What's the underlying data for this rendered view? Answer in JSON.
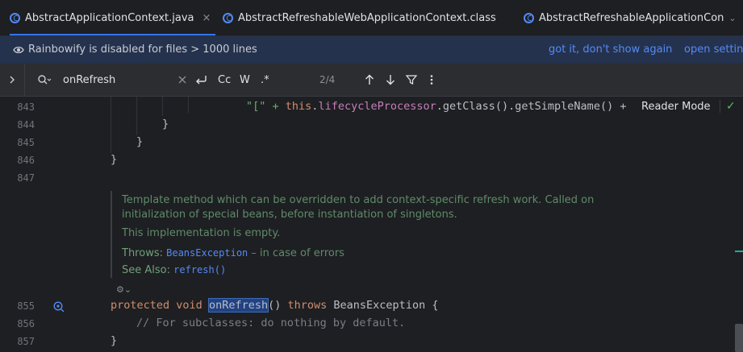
{
  "tabs": [
    {
      "label": "AbstractApplicationContext.java",
      "close": "×"
    },
    {
      "label": "AbstractRefreshableWebApplicationContext.class"
    },
    {
      "label": "AbstractRefreshableApplicationCon"
    }
  ],
  "banner": {
    "text": "Rainbowify is disabled for files > 1000 lines",
    "link_got_it": "got it, don't show again",
    "link_open_settings": "open settin"
  },
  "find": {
    "query": "onRefresh",
    "match_case": "Cc",
    "words": "W",
    "regex": ".*",
    "match_count": "2/4"
  },
  "editor": {
    "reader_mode": "Reader Mode",
    "lines": [
      {
        "num": "843",
        "code_str": "\"[\" + ",
        "code_this": "this",
        "code_dot": ".",
        "code_field": "lifecycleProcessor",
        "code_rest": ".getClass().getSimpleName() +"
      },
      {
        "num": "844",
        "code": "}"
      },
      {
        "num": "845",
        "code": "}"
      },
      {
        "num": "846",
        "code": "}"
      },
      {
        "num": "847",
        "code": ""
      },
      {
        "num": "855",
        "kw1": "protected",
        "kw2": "void",
        "method": "onRefresh",
        "after": "() ",
        "kw3": "throws",
        "tail": " BeansException {"
      },
      {
        "num": "856",
        "comment": "// For subclasses: do nothing by default."
      },
      {
        "num": "857",
        "code": "}"
      }
    ],
    "doc": {
      "line1": "Template method which can be overridden to add context-specific refresh work. Called on",
      "line2": "initialization of special beans, before instantiation of singletons.",
      "line3": "This implementation is empty.",
      "throws_label": "Throws:",
      "throws_type": "BeansException",
      "throws_desc": " – in case of errors",
      "see_label": "See Also:",
      "see_ref": "refresh()"
    }
  }
}
